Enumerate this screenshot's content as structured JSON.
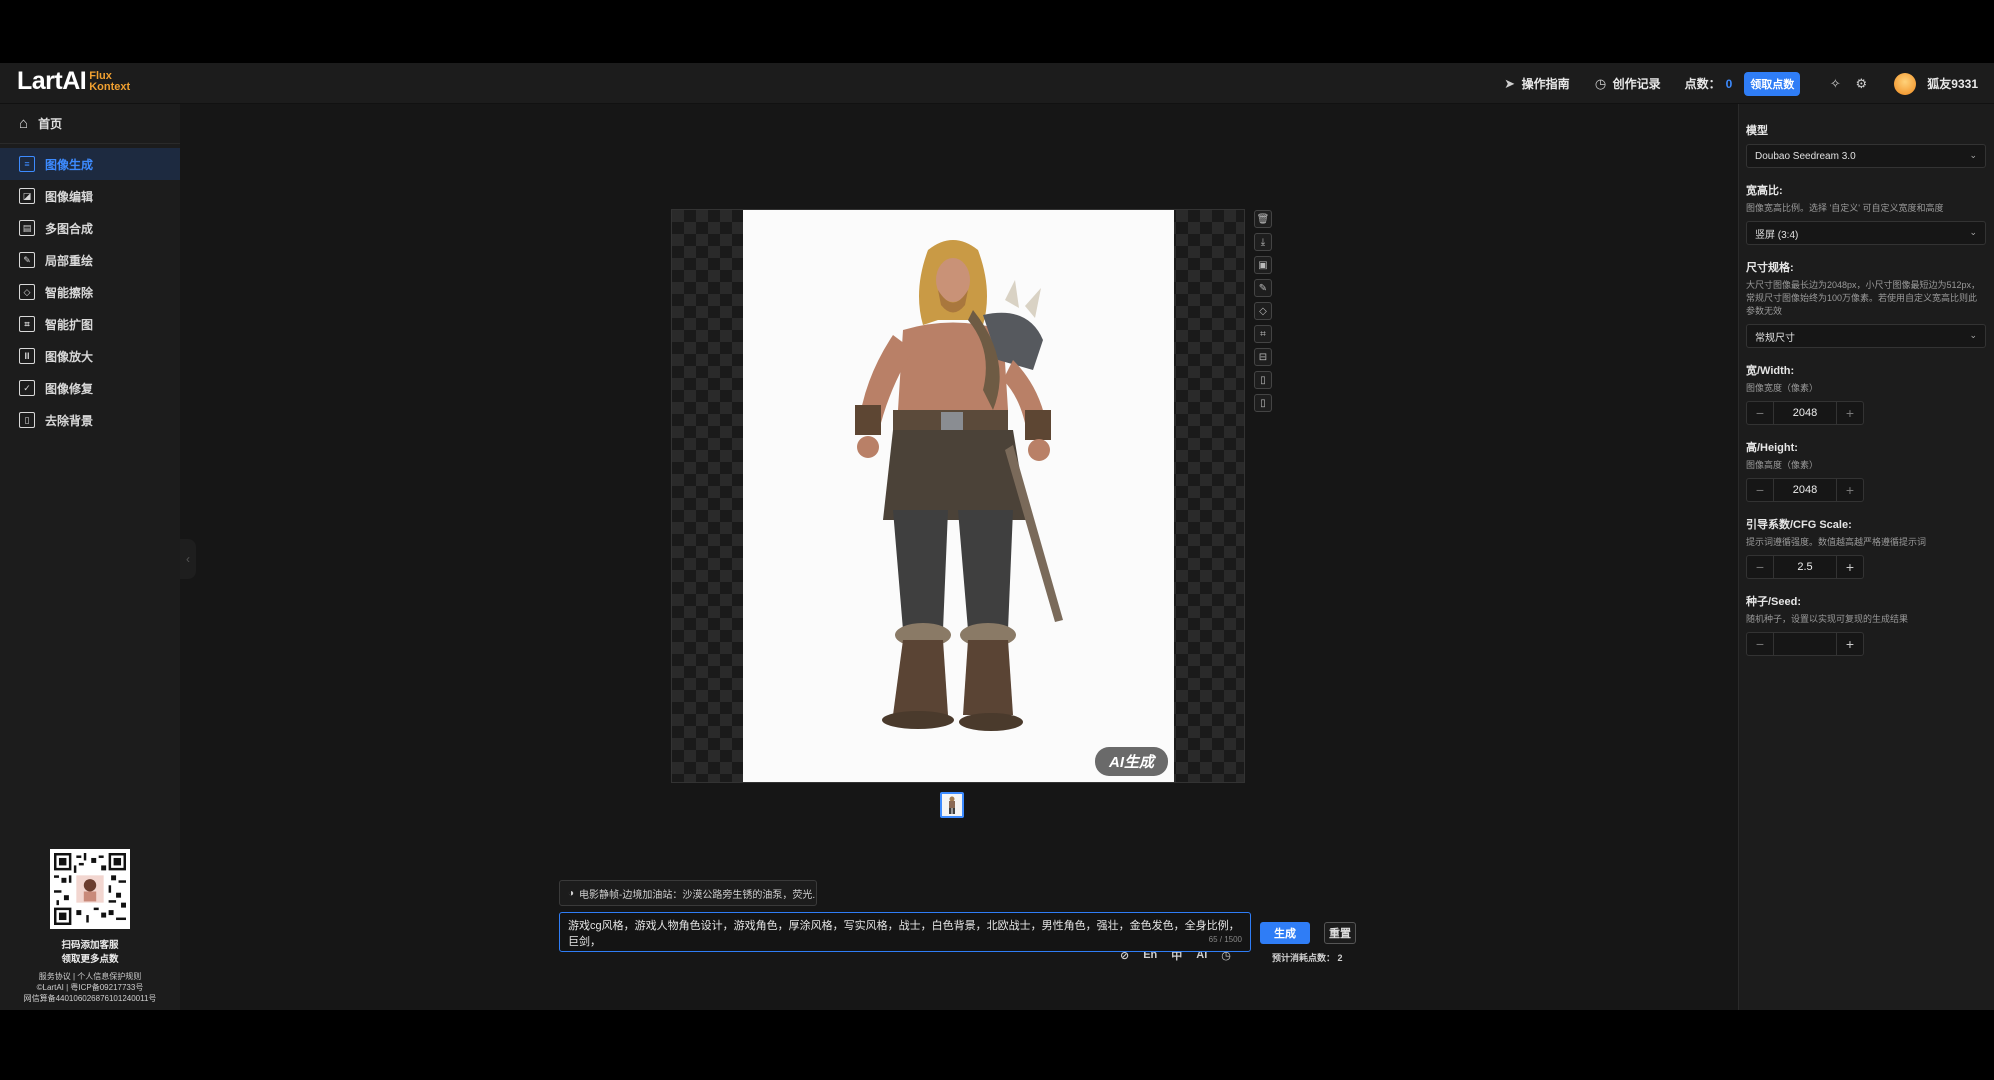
{
  "logo": {
    "main": "LartAI",
    "sub_line1": "Flux",
    "sub_line2": "Kontext"
  },
  "topbar": {
    "guide": "操作指南",
    "history": "创作记录",
    "points_label": "点数：",
    "points_value": "0",
    "claim_button": "领取点数",
    "username": "狐友9331"
  },
  "sidebar": {
    "home": "首页",
    "items": [
      {
        "label": "图像生成",
        "icon": "chat-image-icon"
      },
      {
        "label": "图像编辑",
        "icon": "image-icon"
      },
      {
        "label": "多图合成",
        "icon": "layers-icon"
      },
      {
        "label": "局部重绘",
        "icon": "edit-icon"
      },
      {
        "label": "智能擦除",
        "icon": "eraser-icon"
      },
      {
        "label": "智能扩图",
        "icon": "crop-icon"
      },
      {
        "label": "图像放大",
        "icon": "upscale-icon"
      },
      {
        "label": "图像修复",
        "icon": "repair-icon"
      },
      {
        "label": "去除背景",
        "icon": "remove-bg-icon"
      }
    ],
    "footer": {
      "qr_line1": "扫码添加客服",
      "qr_line2": "领取更多点数",
      "links": "服务协议 | 个人信息保护规则",
      "icp": "©LartAI | 粤ICP备09217733号",
      "police": "网信算备440106026876101240011号"
    }
  },
  "canvas": {
    "badge": "AI生成"
  },
  "prompt": {
    "preset": "电影静帧-边境加油站：沙漠公路旁生锈的油泵，荧光...",
    "text": "游戏cg风格，游戏人物角色设计，游戏角色，厚涂风格，写实风格，战士，白色背景，北欧战士，男性角色，强壮，金色发色，全身比例，巨剑，",
    "count": "65 / 1500",
    "tools": {
      "lang_en": "En",
      "lang_zh": "中",
      "ai": "AI"
    },
    "generate": "生成",
    "reset": "重置",
    "estimate": "预计消耗点数：  2"
  },
  "settings": {
    "model_label": "模型",
    "model_value": "Doubao Seedream 3.0",
    "ratio_label": "宽高比:",
    "ratio_desc": "图像宽高比例。选择 '自定义' 可自定义宽度和高度",
    "ratio_value": "竖屏 (3:4)",
    "size_label": "尺寸规格:",
    "size_desc": "大尺寸图像最长边为2048px，小尺寸图像最短边为512px，常规尺寸图像始终为100万像素。若使用自定义宽高比则此参数无效",
    "size_value": "常规尺寸",
    "width_label": "宽/Width:",
    "width_desc": "图像宽度（像素）",
    "width_value": "2048",
    "height_label": "高/Height:",
    "height_desc": "图像高度（像素）",
    "height_value": "2048",
    "cfg_label": "引导系数/CFG Scale:",
    "cfg_desc": "提示词遵循强度。数值越高越严格遵循提示词",
    "cfg_value": "2.5",
    "seed_label": "种子/Seed:",
    "seed_desc": "随机种子，设置以实现可复现的生成结果",
    "seed_value": ""
  }
}
